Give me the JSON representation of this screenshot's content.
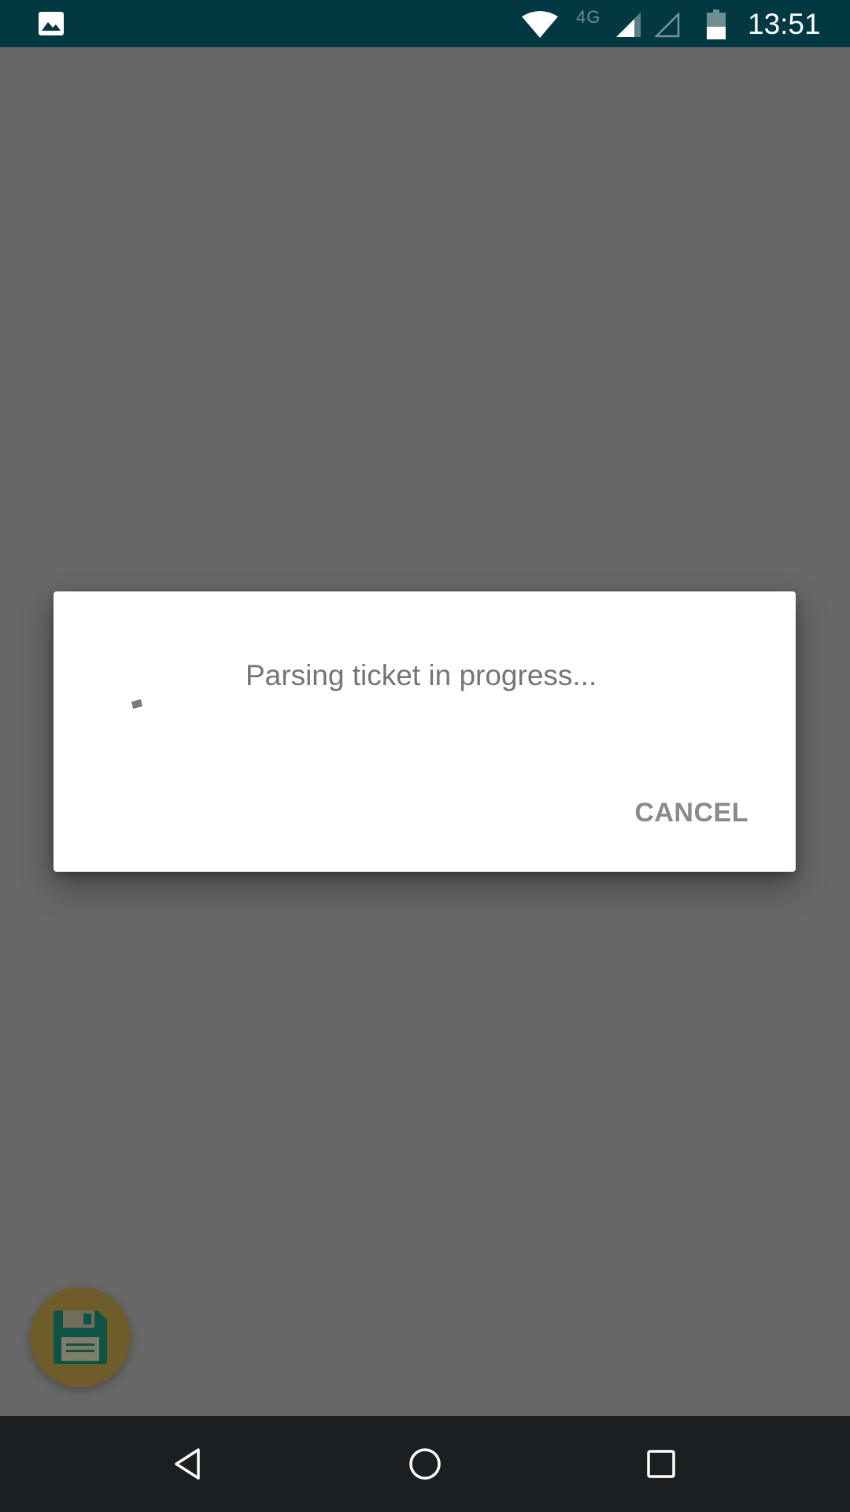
{
  "status_bar": {
    "network_type": "4G",
    "time": "13:51",
    "icons": [
      "gallery-icon",
      "wifi-icon",
      "signal-icon",
      "signal-empty-icon",
      "battery-icon"
    ],
    "background_color": "#013841"
  },
  "dialog": {
    "message": "Parsing ticket in progress...",
    "cancel_label": "CANCEL",
    "progress_indicator": "spinner-icon"
  },
  "fab": {
    "icon": "save-icon",
    "color": "#c9a227"
  },
  "nav_bar": {
    "buttons": [
      "back-icon",
      "home-icon",
      "recents-icon"
    ],
    "background_color": "#1c1f21"
  },
  "colors": {
    "scrim": "#676767",
    "dialog_text": "#757575",
    "button_text": "#8a8a8a"
  }
}
